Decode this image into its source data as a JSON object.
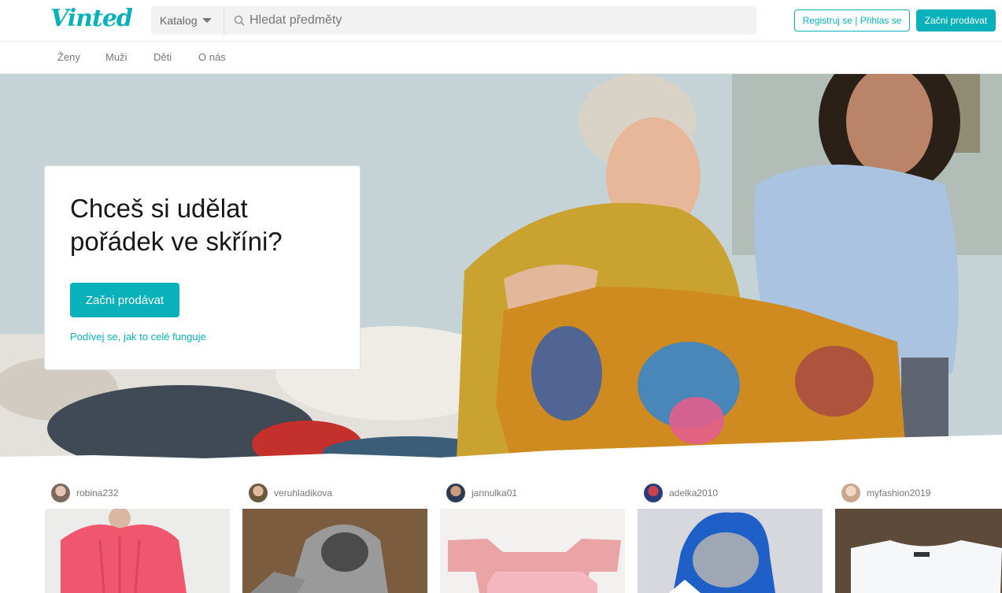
{
  "header": {
    "logo": "Vinted",
    "catalog_label": "Katalog",
    "search_placeholder": "Hledat předměty",
    "register_login_label": "Registruj se | Přihlas se",
    "start_selling_label": "Začni prodávat"
  },
  "nav": {
    "items": [
      "Ženy",
      "Muži",
      "Děti",
      "O nás"
    ]
  },
  "hero": {
    "headline": "Chceš si udělat pořádek ve skříni?",
    "cta_label": "Začni prodávat",
    "link_label": "Podívej se, jak to celé funguje"
  },
  "feed": {
    "users": [
      "robina232",
      "veruhladikova",
      "jannulka01",
      "adelka2010",
      "myfashion2019"
    ]
  },
  "colors": {
    "brand": "#09b1ba",
    "border": "#e8e8e8"
  },
  "icons": [
    "search-icon",
    "chevron-down-icon"
  ]
}
